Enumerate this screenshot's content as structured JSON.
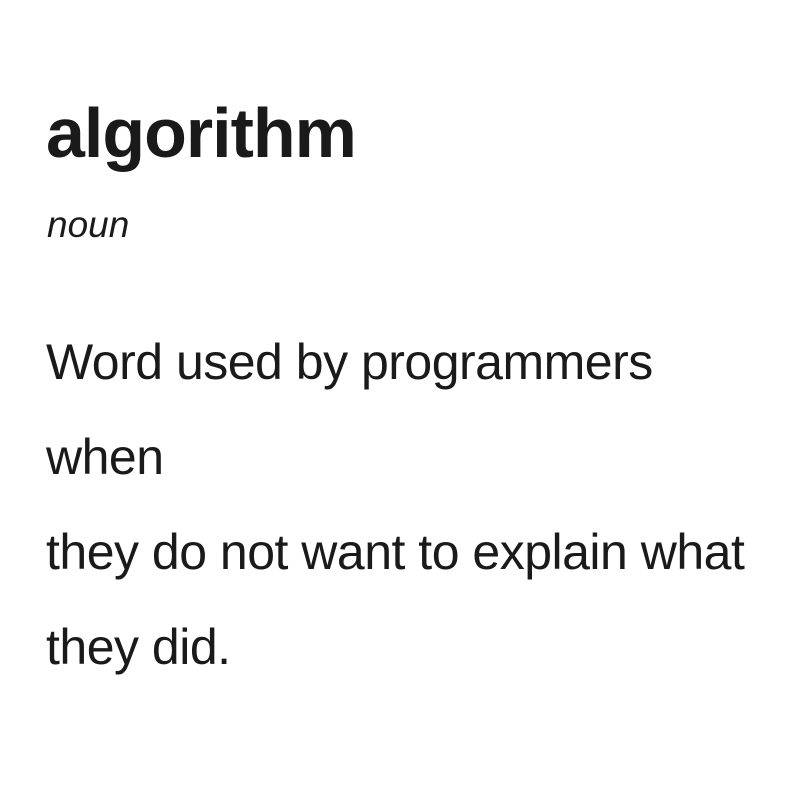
{
  "entry": {
    "headword": "algorithm",
    "part_of_speech": "noun",
    "definition_lines": [
      "Word used by programmers when",
      "they do not want to explain what",
      "they did."
    ]
  },
  "colors": {
    "background": "#ffffff",
    "text": "#1a1a1a"
  }
}
